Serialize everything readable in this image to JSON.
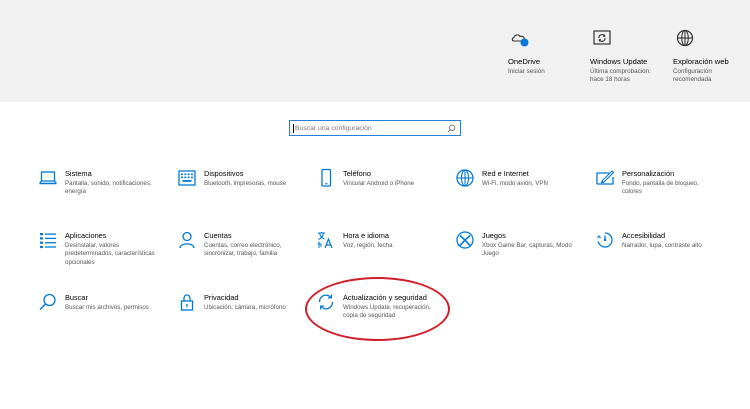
{
  "quick_actions": [
    {
      "title": "OneDrive",
      "subtitle": "Iniciar sesión",
      "icon": "onedrive-cloud-icon"
    },
    {
      "title": "Windows Update",
      "subtitle": "Última comprobación: hace 18 horas",
      "icon": "windows-update-icon"
    },
    {
      "title": "Exploración web",
      "subtitle": "Configuración recomendada",
      "icon": "globe-icon"
    }
  ],
  "search": {
    "placeholder": "Buscar una configuración",
    "icon": "search-icon"
  },
  "categories": [
    {
      "title": "Sistema",
      "desc": "Pantalla, sonido, notificaciones, energía",
      "icon": "laptop-icon"
    },
    {
      "title": "Dispositivos",
      "desc": "Bluetooth, impresoras, mouse",
      "icon": "keyboard-icon"
    },
    {
      "title": "Teléfono",
      "desc": "Vincular Android o iPhone",
      "icon": "phone-icon"
    },
    {
      "title": "Red e Internet",
      "desc": "Wi-Fi, modo avión, VPN",
      "icon": "globe-icon"
    },
    {
      "title": "Personalización",
      "desc": "Fondo, pantalla de bloqueo, colores",
      "icon": "paint-icon"
    },
    {
      "title": "Aplicaciones",
      "desc": "Desinstalar, valores predeterminados, características opcionales",
      "icon": "apps-list-icon"
    },
    {
      "title": "Cuentas",
      "desc": "Cuentas, correo electrónico, sincronizar, trabajo, familia",
      "icon": "person-icon"
    },
    {
      "title": "Hora e idioma",
      "desc": "Voz, región, fecha",
      "icon": "time-language-icon"
    },
    {
      "title": "Juegos",
      "desc": "Xbox Game Bar, capturas, Modo Juego",
      "icon": "xbox-icon"
    },
    {
      "title": "Accesibilidad",
      "desc": "Narrador, lupa, contraste alto",
      "icon": "accessibility-icon"
    },
    {
      "title": "Buscar",
      "desc": "Buscar mis archivos, permisos",
      "icon": "search-icon"
    },
    {
      "title": "Privacidad",
      "desc": "Ubicación, cámara, micrófono",
      "icon": "lock-icon"
    },
    {
      "title": "Actualización y seguridad",
      "desc": "Windows Update, recuperación, copia de seguridad",
      "icon": "sync-icon"
    }
  ],
  "colors": {
    "accent": "#0078d7",
    "highlight_ring": "#d11f2a",
    "top_band": "#f1f1f1"
  }
}
